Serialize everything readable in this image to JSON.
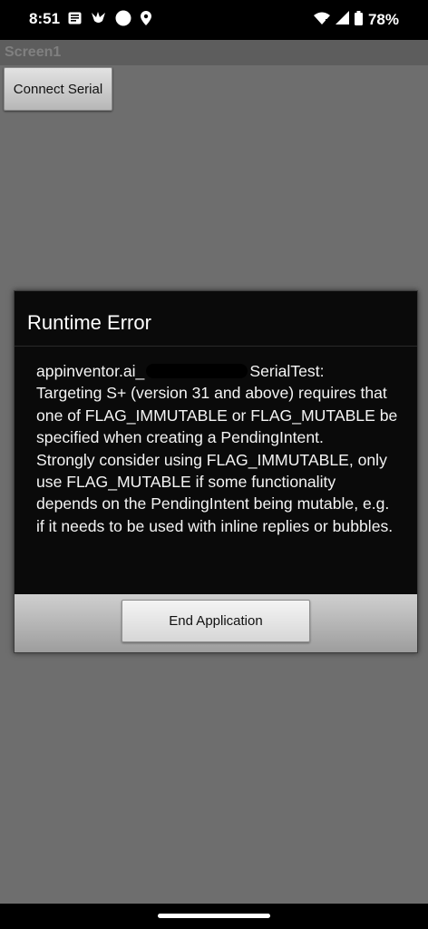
{
  "status_bar": {
    "time": "8:51",
    "battery": "78%",
    "icons_left": [
      "news-icon",
      "bird-icon",
      "circle-dot-icon",
      "location-icon"
    ],
    "icons_right": [
      "wifi-icon",
      "signal-icon",
      "battery-icon"
    ]
  },
  "screen": {
    "title": "Screen1"
  },
  "connect_button": {
    "label": "Connect Serial"
  },
  "dialog": {
    "title": "Runtime Error",
    "message_start": "appinventor.ai_",
    "message_after_redaction": "SerialTest:\nTargeting S+ (version 31 and above) requires that one of FLAG_IMMUTABLE or FLAG_MUTABLE be specified when creating a PendingIntent.\nStrongly consider using FLAG_IMMUTABLE, only use FLAG_MUTABLE if some functionality depends on the PendingIntent being mutable, e.g. if it needs to be used with inline replies or bubbles.",
    "end_button_label": "End Application"
  }
}
